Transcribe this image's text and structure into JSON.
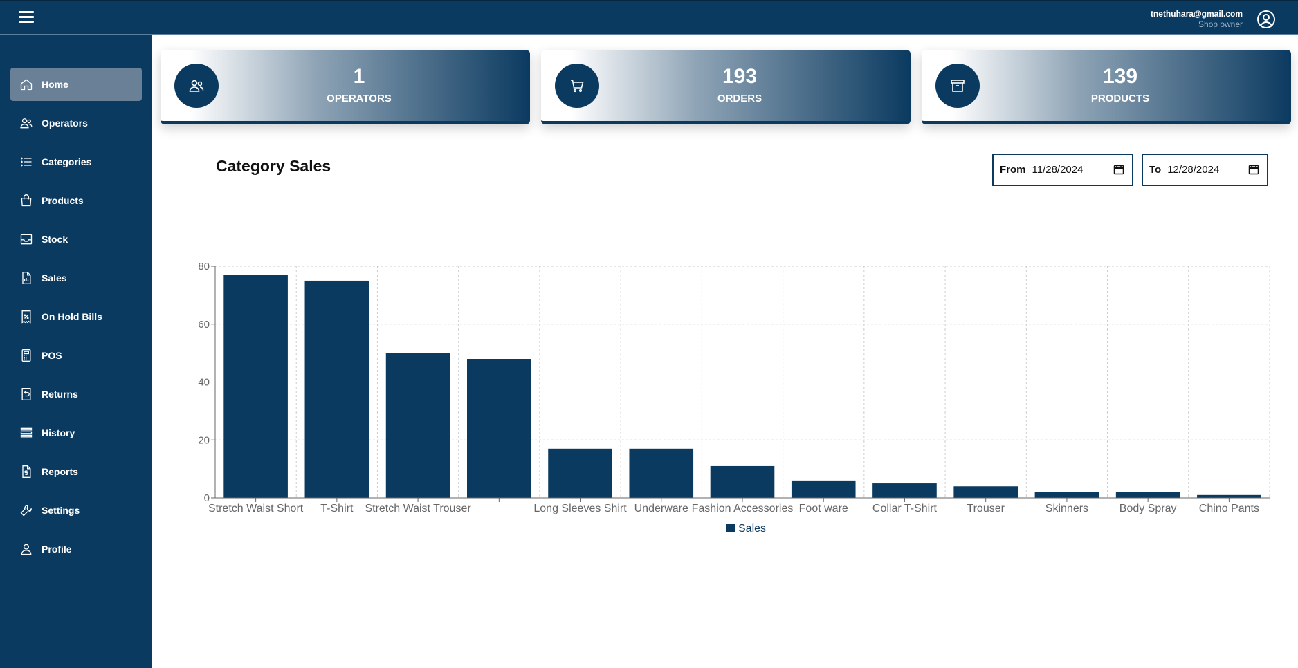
{
  "header": {
    "menu_icon": "hamburger-icon",
    "user_email": "tnethuhara@gmail.com",
    "user_role": "Shop owner",
    "avatar_icon": "user-circle-icon"
  },
  "sidebar": {
    "items": [
      {
        "label": "Home",
        "icon": "home-icon",
        "active": true
      },
      {
        "label": "Operators",
        "icon": "users-icon",
        "active": false
      },
      {
        "label": "Categories",
        "icon": "list-icon",
        "active": false
      },
      {
        "label": "Products",
        "icon": "shopping-bag-icon",
        "active": false
      },
      {
        "label": "Stock",
        "icon": "inbox-icon",
        "active": false
      },
      {
        "label": "Sales",
        "icon": "file-chart-icon",
        "active": false
      },
      {
        "label": "On Hold Bills",
        "icon": "receipt-percent-icon",
        "active": false
      },
      {
        "label": "POS",
        "icon": "calculator-icon",
        "active": false
      },
      {
        "label": "Returns",
        "icon": "return-icon",
        "active": false
      },
      {
        "label": "History",
        "icon": "history-icon",
        "active": false
      },
      {
        "label": "Reports",
        "icon": "file-dollar-icon",
        "active": false
      },
      {
        "label": "Settings",
        "icon": "wrench-icon",
        "active": false
      },
      {
        "label": "Profile",
        "icon": "user-icon",
        "active": false
      }
    ]
  },
  "stats": [
    {
      "value": "1",
      "label": "OPERATORS",
      "icon": "users-icon"
    },
    {
      "value": "193",
      "label": "ORDERS",
      "icon": "cart-icon"
    },
    {
      "value": "139",
      "label": "PRODUCTS",
      "icon": "archive-icon"
    }
  ],
  "section_title": "Category Sales",
  "filters": {
    "from_label": "From",
    "from_value": "11/28/2024",
    "to_label": "To",
    "to_value": "12/28/2024"
  },
  "colors": {
    "primary": "#0b3a60",
    "active_nav": "#6a8096",
    "grid": "#cccccc"
  },
  "chart_data": {
    "type": "bar",
    "categories": [
      "Stretch Waist Short",
      "T-Shirt",
      "Stretch Waist Trouser",
      "",
      "Long Sleeves Shirt",
      "Underware",
      "Fashion Accessories",
      "Foot ware",
      "Collar T-Shirt",
      "Trouser",
      "Skinners",
      "Body Spray",
      "Chino Pants"
    ],
    "series": [
      {
        "name": "Sales",
        "values": [
          77,
          75,
          50,
          48,
          17,
          17,
          11,
          6,
          5,
          4,
          2,
          2,
          1
        ]
      }
    ],
    "ylim": [
      0,
      80
    ],
    "yticks": [
      0,
      20,
      40,
      60,
      80
    ],
    "grid": true,
    "legend": "bottom",
    "title": "",
    "xlabel": "",
    "ylabel": ""
  }
}
